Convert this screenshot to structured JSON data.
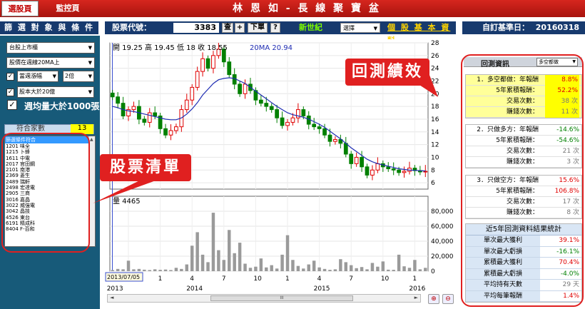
{
  "top": {
    "tab_active": "選股頁",
    "tab_inactive": "監控頁",
    "title": "林 恩 如 - 長 線 聚 寶 盆"
  },
  "header": {
    "filter_title": "篩 選 對 象 與 條 件",
    "code_label": "股票代號：",
    "code_value": "3383",
    "btn_search": "查",
    "btn_add": "+",
    "btn_next": "下單",
    "btn_help": "?",
    "era_label": "新世紀",
    "small_select": "選擇",
    "basic_link": "個 股 基 本 資 料",
    "base_date_label": "自訂基準日：",
    "base_date_value": "20160318"
  },
  "filters": {
    "market": "台股上市櫃",
    "ma_condition": "股價在週線20MA上",
    "cond1": "當週漲幅",
    "cond1_n": "2倍",
    "cond2": "股本大於20億",
    "volume_label": "週均量大於1000張",
    "match_label": "符合家數",
    "match_count": "13"
  },
  "stock_list": {
    "header": "篩選條件符合",
    "items": [
      "1201 味全",
      "1215 卜蜂",
      "1611 中電",
      "2017 官田鋼",
      "2101 南港",
      "2369 菱生",
      "2489 瑞軒",
      "2498 宏達電",
      "2905 三商",
      "3016 嘉晶",
      "3022 威強電",
      "3042 晶技",
      "4526 東台",
      "6191 精成科",
      "8404 F-百和"
    ]
  },
  "chart": {
    "price_info": "開 19.25  高 19.45  低 18  收 18.55",
    "ma_label": "20MA 20.94",
    "vol_label": "量 4465",
    "date_badge": "2013/07/05",
    "x_months": [
      "10",
      "1",
      "4",
      "7",
      "10",
      "1",
      "4",
      "7",
      "10",
      "1"
    ],
    "x_years": [
      "2013",
      "2014",
      "2015",
      "2016"
    ],
    "price_ticks": [
      "28",
      "26",
      "24",
      "22",
      "20",
      "18",
      "16",
      "14",
      "12",
      "10",
      "8",
      "6"
    ],
    "vol_ticks": [
      "80,000",
      "60,000",
      "40,000",
      "20,000",
      "0"
    ],
    "scroll_mid": "III"
  },
  "chart_data": {
    "type": "candlestick",
    "title": "",
    "ylim": [
      5,
      28
    ],
    "vol_ylim": [
      0,
      100000
    ],
    "current_bar": {
      "open": 19.25,
      "high": 19.45,
      "low": 18,
      "close": 18.55,
      "ma20": 20.94,
      "volume": 4465
    },
    "close_weekly_approx": [
      19.5,
      18.5,
      16.5,
      17.5,
      18,
      16,
      15.5,
      17,
      16.5,
      14.5,
      13.5,
      14.2,
      14.8,
      17.5,
      19,
      21,
      23.5,
      25.5,
      24,
      26,
      27,
      25,
      23,
      21.5,
      20,
      21.5,
      20.5,
      19,
      18.5,
      18,
      17.5,
      16.2,
      15,
      15.5,
      16.2,
      17.5,
      16.5,
      15.2,
      14.8,
      14.5,
      13.5,
      12.5,
      12.8,
      12.2,
      10.5,
      9,
      10,
      8.5,
      7.2,
      8,
      9,
      8.5,
      8.2,
      8,
      7.6,
      7.8,
      8.3,
      7.9,
      7.7,
      7.8
    ],
    "ma20_weekly_approx": [
      18,
      17.8,
      17.5,
      17.3,
      17.2,
      17,
      16.8,
      16.6,
      16.4,
      16.2,
      16,
      15.9,
      15.9,
      16.2,
      16.8,
      17.6,
      18.6,
      19.8,
      20.7,
      21.6,
      22.2,
      22.4,
      22.5,
      22.4,
      22,
      21.6,
      21,
      20.4,
      19.8,
      19.2,
      18.6,
      18,
      17.5,
      17,
      16.7,
      16.5,
      16.3,
      16,
      15.6,
      15.2,
      14.7,
      14.1,
      13.5,
      12.9,
      12.2,
      11.5,
      10.9,
      10.3,
      9.7,
      9.3,
      9,
      8.8,
      8.6,
      8.4,
      8.2,
      8.1,
      8,
      7.95,
      7.9,
      7.85
    ],
    "volume_weekly_approx": [
      1500,
      3000,
      2500,
      14000,
      2500,
      3000,
      2000,
      1500,
      2500,
      1800,
      2200,
      1500,
      4500,
      3000,
      9000,
      34000,
      52000,
      22000,
      12000,
      78000,
      28000,
      15000,
      55000,
      24000,
      38000,
      10000,
      4500,
      6000,
      17000,
      5000,
      8000,
      3500,
      22000,
      48000,
      15000,
      7000,
      3500,
      9000,
      14000,
      5000,
      3000,
      1800,
      2500,
      16000,
      12000,
      8000,
      4000,
      5500,
      2500,
      11000,
      6000,
      13000,
      2000,
      1800,
      22000,
      6500,
      4500,
      15000,
      2500,
      4465
    ]
  },
  "backtest": {
    "header": "回測資訊",
    "select": "多空都做",
    "sect1": [
      {
        "k": "1．多空都做：年報酬",
        "v": "8.8%"
      },
      {
        "k": "5年累積報酬：",
        "v": "52.2%"
      },
      {
        "k": "交易次數：",
        "v": "38 次"
      },
      {
        "k": "賺錢次數：",
        "v": "11 次"
      }
    ],
    "sect2": [
      {
        "k": "2．只做多方：年報酬",
        "v": "-14.6%"
      },
      {
        "k": "5年累積報酬：",
        "v": "-54.6%"
      },
      {
        "k": "交易次數：",
        "v": "21 次"
      },
      {
        "k": "賺錢次數：",
        "v": "3 次"
      }
    ],
    "sect3": [
      {
        "k": "3．只做空方：年報酬",
        "v": "15.6%"
      },
      {
        "k": "5年累積報酬：",
        "v": "106.8%"
      },
      {
        "k": "交易次數：",
        "v": "17 次"
      },
      {
        "k": "賺錢次數：",
        "v": "8 次"
      }
    ],
    "stats_title": "近5年回測資料結果統計",
    "stats": [
      {
        "k": "單次最大獲利",
        "v": "39.1%"
      },
      {
        "k": "單次最大虧損",
        "v": "-16.1%"
      },
      {
        "k": "累積最大獲利",
        "v": "70.4%"
      },
      {
        "k": "累積最大虧損",
        "v": "-4.0%"
      },
      {
        "k": "平均持有天數",
        "v": "29 天"
      },
      {
        "k": "平均每筆報酬",
        "v": "1.4%"
      }
    ]
  },
  "callouts": {
    "backtest": "回測績效",
    "list": "股票清單"
  }
}
